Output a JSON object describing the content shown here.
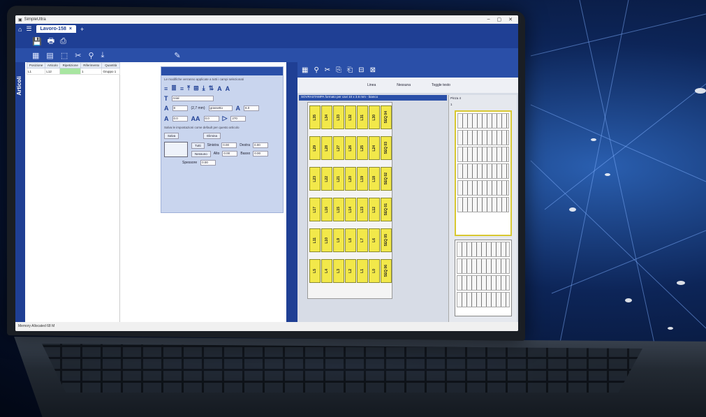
{
  "window": {
    "app_title": "SimpleUltra"
  },
  "tabs": [
    {
      "label": "Lavoro-158"
    }
  ],
  "sidebar": {
    "vertical_tab": "Articoli"
  },
  "grid": {
    "headers": [
      "Posizione",
      "Articolo",
      "Ripetizione",
      "Riferimento",
      "Quantità"
    ],
    "rows": [
      [
        "L1",
        "L12",
        "",
        "1",
        "Gruppo 1"
      ]
    ]
  },
  "format_panel": {
    "note": "Le modifiche verranno applicate a tutti i campi selezionati",
    "font_name": "Arial",
    "size_value": "8",
    "size_mm": "(2,7 mm)",
    "style_value": "grassetto",
    "scale_value": "8.0",
    "spacing_value": "0.0",
    "char_spacing_value": "0.0",
    "rotation_value": "270",
    "defaults_note": "Salva le impostazioni come default per questo articolo",
    "save_label": "Salva",
    "delete_label": "Elimina",
    "all_label": "Tutti",
    "none_label": "Nessuno",
    "left_label": "Sinistra",
    "right_label": "Destra",
    "top_label": "Alto",
    "bottom_label": "Basso",
    "left_val": "0.00",
    "right_val": "0.00",
    "top_val": "0.00",
    "bottom_val": "0.00",
    "thickness_label": "Spessore",
    "thickness_val": "0.00"
  },
  "labels": {
    "header": "SOVRASTAMPA formato per cavi 10 x 3.6 mm - bianco",
    "toolbar_labels": [
      "Linea",
      "Nessuna"
    ],
    "toggle_text": "Toggle testo",
    "right_header": "Pinza 4",
    "right_value": "1",
    "rows": [
      [
        "L35",
        "L34",
        "L33",
        "L32",
        "L31",
        "L30",
        "SEQ 04"
      ],
      [
        "L29",
        "L28",
        "L27",
        "L26",
        "L25",
        "L24",
        "SEQ 03"
      ],
      [
        "L23",
        "L22",
        "L21",
        "L20",
        "L19",
        "L18",
        "SEQ 02"
      ],
      [
        "L17",
        "L16",
        "L15",
        "L14",
        "L13",
        "L12",
        "SEQ 01"
      ],
      [
        "L11",
        "L10",
        "L9",
        "L8",
        "L7",
        "L6",
        "SEQ 05"
      ],
      [
        "L5",
        "L4",
        "L3",
        "L2",
        "L1",
        "L0",
        "SEQ 06"
      ]
    ]
  },
  "status": {
    "text": "Memory Allocated 68 M"
  },
  "colors": {
    "brand": "#1f3f94",
    "label_fill": "#f2e84a"
  }
}
